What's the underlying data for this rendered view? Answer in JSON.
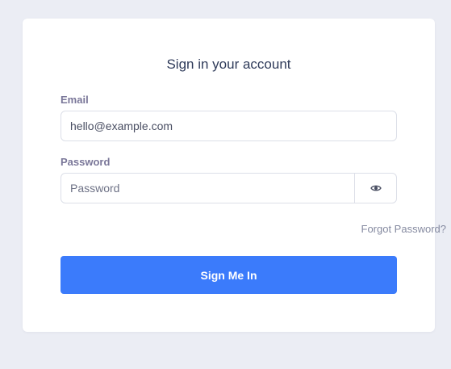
{
  "form": {
    "title": "Sign in your account",
    "email": {
      "label": "Email",
      "value": "hello@example.com",
      "placeholder": ""
    },
    "password": {
      "label": "Password",
      "value": "",
      "placeholder": "Password",
      "toggle_icon": "eye-icon"
    },
    "forgot_label": "Forgot Password?",
    "submit_label": "Sign Me In"
  },
  "colors": {
    "background": "#ebedf4",
    "card": "#ffffff",
    "title": "#2e3a59",
    "label": "#7a7799",
    "border": "#dcdfe8",
    "link": "#858aa0",
    "accent": "#3b7bfb"
  }
}
